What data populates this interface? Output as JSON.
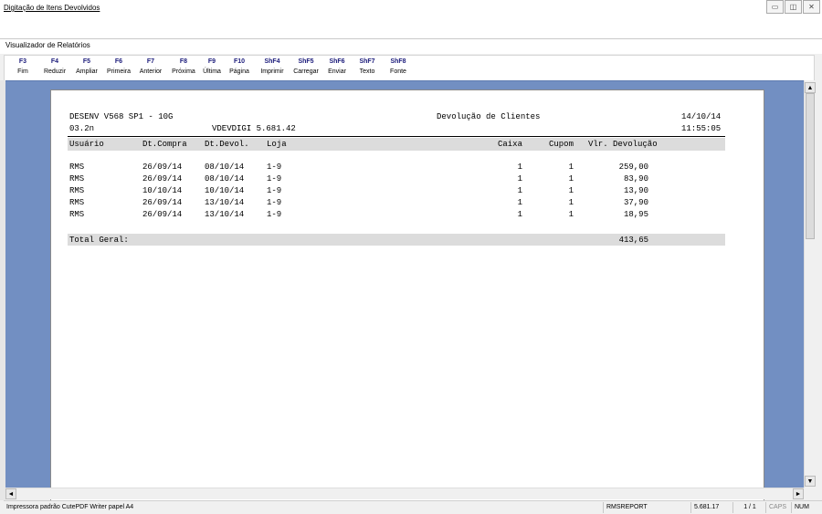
{
  "outer_window": {
    "title": "Digitação de Itens Devolvidos",
    "controls": {
      "minimize": "▭",
      "maximize": "◫",
      "close": "✕"
    }
  },
  "window": {
    "title": "Visualizador de Relatórios"
  },
  "toolbar": {
    "buttons": [
      {
        "key": "F3",
        "label": "Fim"
      },
      {
        "key": "F4",
        "label": "Reduzir"
      },
      {
        "key": "F5",
        "label": "Ampliar"
      },
      {
        "key": "F6",
        "label": "Primeira"
      },
      {
        "key": "F7",
        "label": "Anterior"
      },
      {
        "key": "F8",
        "label": "Próxima"
      },
      {
        "key": "F9",
        "label": "Última"
      },
      {
        "key": "F10",
        "label": "Página"
      },
      {
        "key": "ShF4",
        "label": "Imprimir"
      },
      {
        "key": "ShF5",
        "label": "Carregar"
      },
      {
        "key": "ShF6",
        "label": "Enviar"
      },
      {
        "key": "ShF7",
        "label": "Texto"
      },
      {
        "key": "ShF8",
        "label": "Fonte"
      }
    ]
  },
  "report": {
    "system": "DESENV V568 SP1 - 10G",
    "version": "03.2n",
    "program": "VDEVDIGI 5.681.42",
    "title": "Devolução de Clientes",
    "date": "14/10/14",
    "time": "11:55:05",
    "columns": [
      "Usuário",
      "Dt.Compra",
      "Dt.Devol.",
      "Loja",
      "Caixa",
      "Cupom",
      "Vlr. Devolução"
    ],
    "rows": [
      [
        "RMS",
        "26/09/14",
        "08/10/14",
        "1-9",
        "1",
        "1",
        "259,00"
      ],
      [
        "RMS",
        "26/09/14",
        "08/10/14",
        "1-9",
        "1",
        "1",
        "83,90"
      ],
      [
        "RMS",
        "10/10/14",
        "10/10/14",
        "1-9",
        "1",
        "1",
        "13,90"
      ],
      [
        "RMS",
        "26/09/14",
        "13/10/14",
        "1-9",
        "1",
        "1",
        "37,90"
      ],
      [
        "RMS",
        "26/09/14",
        "13/10/14",
        "1-9",
        "1",
        "1",
        "18,95"
      ]
    ],
    "total_label": "Total Geral:",
    "total_value": "413,65"
  },
  "scroll": {
    "up": "▲",
    "down": "▼",
    "left": "◄",
    "right": "►"
  },
  "statusbar": {
    "printer": "Impressora padrão CutePDF Writer papel A4",
    "report_name": "RMSREPORT",
    "version": "5.681.17",
    "pages": "1 / 1",
    "caps": "CAPS",
    "num": "NUM"
  }
}
